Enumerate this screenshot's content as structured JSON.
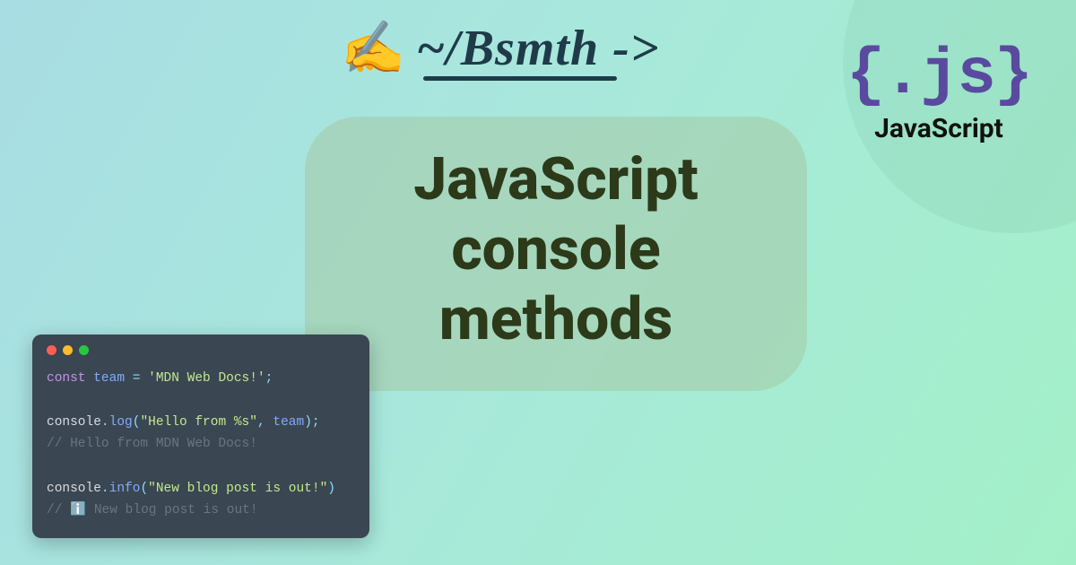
{
  "header": {
    "emoji": "✍️",
    "signature": "~/Bsmth ->"
  },
  "logo": {
    "braces": "{.js}",
    "label": "JavaScript"
  },
  "title": {
    "line1": "JavaScript",
    "line2": "console methods"
  },
  "code": {
    "l1_keyword": "const",
    "l1_var": " team",
    "l1_eq": " = ",
    "l1_str": "'MDN Web Docs!'",
    "l1_end": ";",
    "l3_obj": "console",
    "l3_dot": ".",
    "l3_method": "log",
    "l3_open": "(",
    "l3_str": "\"Hello from %s\"",
    "l3_comma": ", ",
    "l3_arg": "team",
    "l3_close": ");",
    "l4_comment": "// Hello from MDN Web Docs!",
    "l6_obj": "console",
    "l6_dot": ".",
    "l6_method": "info",
    "l6_open": "(",
    "l6_str": "\"New blog post is out!\"",
    "l6_close": ")",
    "l7_comment": "// ℹ️ New blog post is out!"
  }
}
